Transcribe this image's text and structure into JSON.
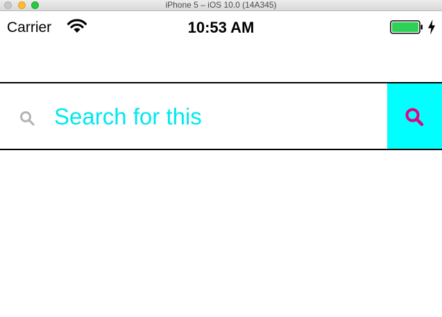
{
  "window": {
    "title": "iPhone 5 – iOS 10.0 (14A345)"
  },
  "status_bar": {
    "carrier": "Carrier",
    "time": "10:53 AM",
    "wifi_icon": "wifi-icon",
    "battery_icon": "battery-icon",
    "charging_icon": "charging-bolt-icon",
    "battery_level": 1.0,
    "battery_color": "#2ed158"
  },
  "search": {
    "leading_icon": "search-icon",
    "placeholder": "Search for this",
    "value": "",
    "text_color": "#00e8f0",
    "button_icon": "search-icon",
    "button_background": "#00ffff",
    "button_icon_color": "#e6007e"
  }
}
